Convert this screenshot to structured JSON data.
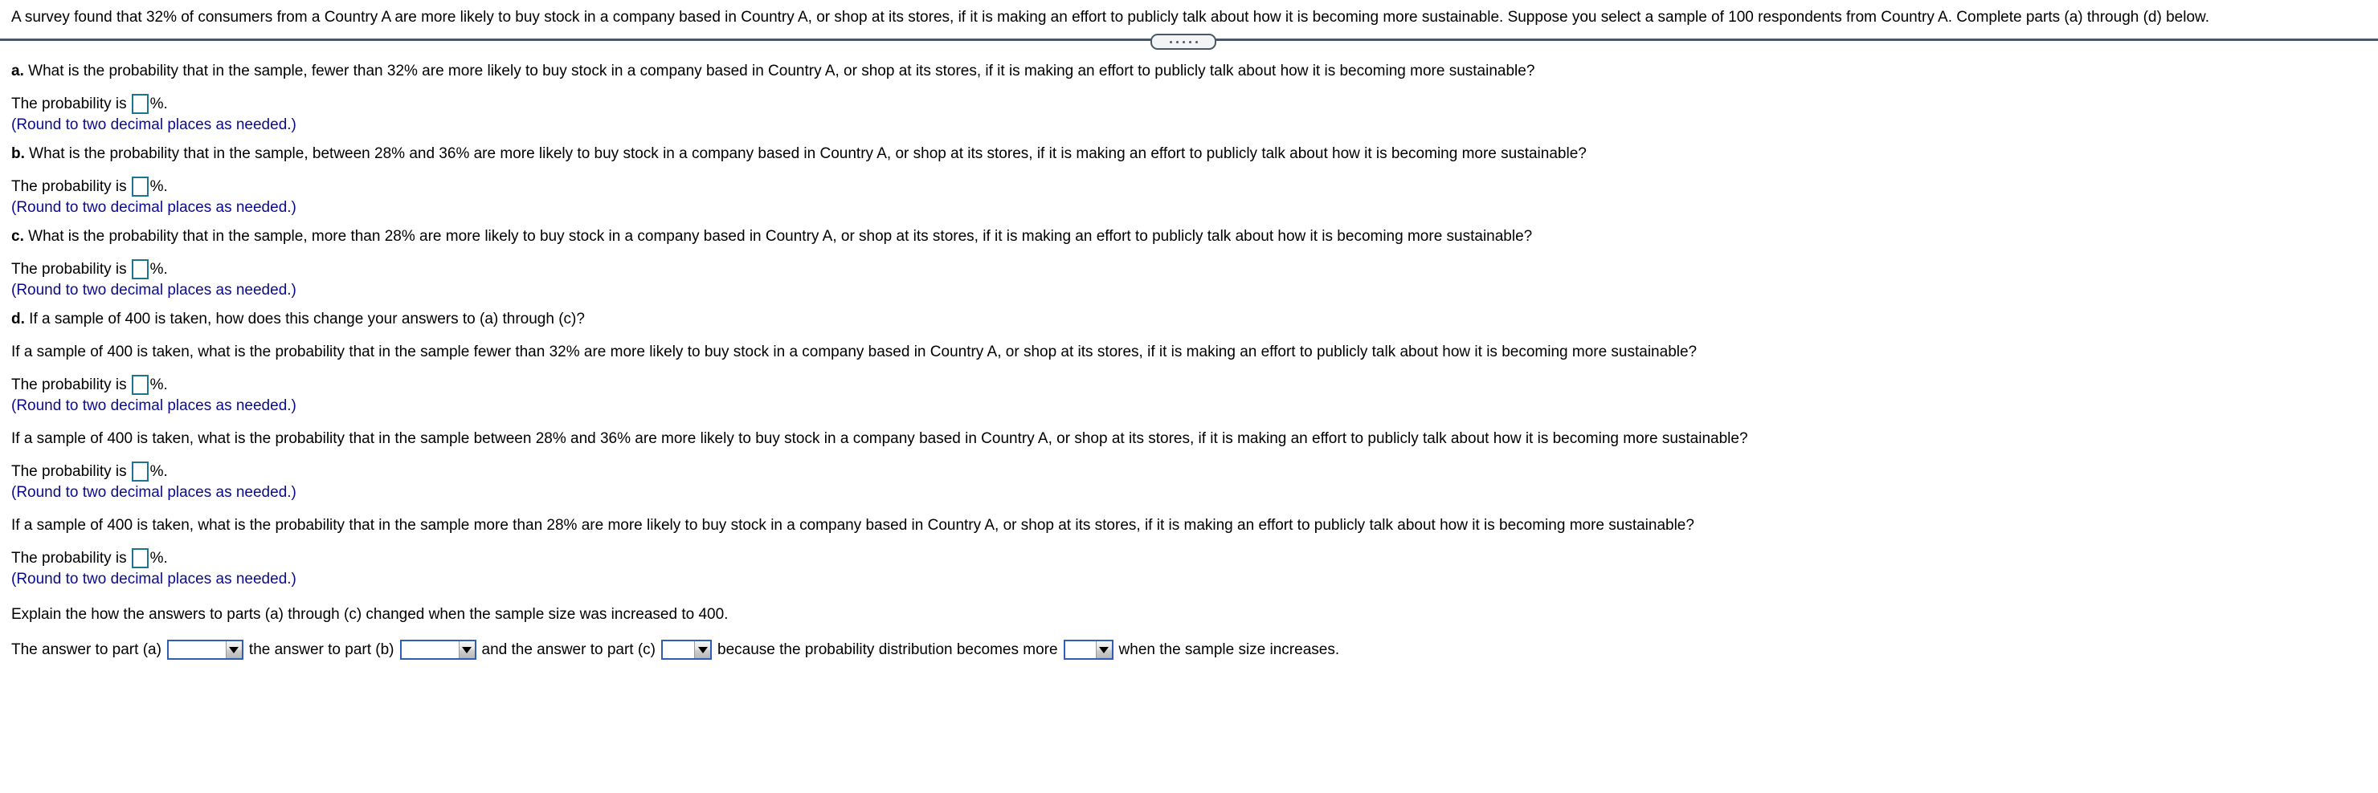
{
  "problem": {
    "statement": "A survey found that 32% of consumers from a Country A are more likely to buy stock in a company based in Country A, or shop at its stores, if it is making an effort to publicly talk about how it is becoming more sustainable. Suppose you select a sample of 100 respondents from Country A. Complete parts (a) through (d) below."
  },
  "splitter": {
    "dots": 5
  },
  "parts": {
    "a": {
      "label": "a.",
      "question": "What is the probability that in the sample, fewer than 32% are more likely to buy stock in a company based in Country A, or shop at its stores, if it is making an effort to publicly talk about how it is becoming more sustainable?",
      "answer_lead": "The probability is",
      "answer_value": "",
      "answer_suffix": "%.",
      "hint": "(Round to two decimal places as needed.)"
    },
    "b": {
      "label": "b.",
      "question": "What is the probability that in the sample, between 28% and 36% are more likely to buy stock in a company based in Country A, or shop at its stores, if it is making an effort to publicly talk about how it is becoming more sustainable?",
      "answer_lead": "The probability is",
      "answer_value": "",
      "answer_suffix": "%.",
      "hint": "(Round to two decimal places as needed.)"
    },
    "c": {
      "label": "c.",
      "question": "What is the probability that in the sample, more than 28% are more likely to buy stock in a company based in Country A, or shop at its stores, if it is making an effort to publicly talk about how it is becoming more sustainable?",
      "answer_lead": "The probability is",
      "answer_suffix": "%.",
      "answer_value": "",
      "hint": "(Round to two decimal places as needed.)"
    },
    "d": {
      "label": "d.",
      "question": "If a sample of 400 is taken, how does this change your answers to (a) through (c)?",
      "sub": [
        {
          "question": "If a sample of 400 is taken, what is the probability that in the sample fewer than 32% are more likely to buy stock in a company based in Country A, or shop at its stores, if it is making an effort to publicly talk about how it is becoming more sustainable?",
          "answer_lead": "The probability is",
          "answer_value": "",
          "answer_suffix": "%.",
          "hint": "(Round to two decimal places as needed.)"
        },
        {
          "question": "If a sample of 400 is taken, what is the probability that in the sample between 28% and 36% are more likely to buy stock in a company based in Country A, or shop at its stores, if it is making an effort to publicly talk about how it is becoming more sustainable?",
          "answer_lead": "The probability is",
          "answer_value": "",
          "answer_suffix": "%.",
          "hint": "(Round to two decimal places as needed.)"
        },
        {
          "question": "If a sample of 400 is taken, what is the probability that in the sample more than 28% are more likely to buy stock in a company based in Country A, or shop at its stores, if it is making an effort to publicly talk about how it is becoming more sustainable?",
          "answer_lead": "The probability is",
          "answer_value": "",
          "answer_suffix": "%.",
          "hint": "(Round to two decimal places as needed.)"
        }
      ],
      "explain_prompt": "Explain the how the answers to parts (a) through (c) changed when the sample size was increased to 400.",
      "conclusion": {
        "text_1": "The answer to part (a)",
        "select_a_value": "",
        "text_2": "the answer to part (b)",
        "select_b_value": "",
        "text_3": "and the answer to part (c)",
        "select_c_value": "",
        "text_4": "because the probability distribution becomes more",
        "select_d_value": "",
        "text_5": "when the sample size increases."
      }
    }
  },
  "colors": {
    "hint_blue": "#0b0b8b",
    "input_border_teal": "#1d7391",
    "select_border_blue": "#2f5fb4",
    "divider_slate": "#4a5764"
  }
}
